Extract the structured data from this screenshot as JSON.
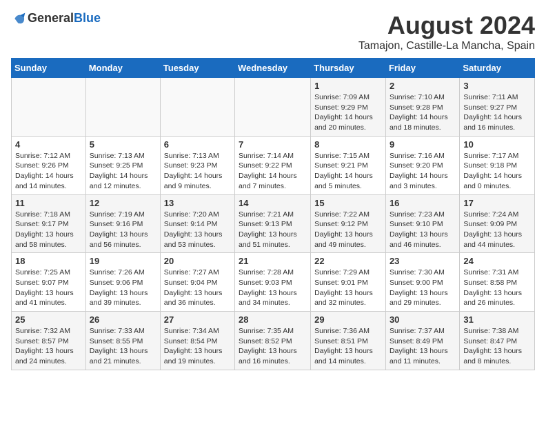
{
  "logo": {
    "text_general": "General",
    "text_blue": "Blue"
  },
  "title": "August 2024",
  "subtitle": "Tamajon, Castille-La Mancha, Spain",
  "weekdays": [
    "Sunday",
    "Monday",
    "Tuesday",
    "Wednesday",
    "Thursday",
    "Friday",
    "Saturday"
  ],
  "weeks": [
    [
      {
        "day": "",
        "content": ""
      },
      {
        "day": "",
        "content": ""
      },
      {
        "day": "",
        "content": ""
      },
      {
        "day": "",
        "content": ""
      },
      {
        "day": "1",
        "content": "Sunrise: 7:09 AM\nSunset: 9:29 PM\nDaylight: 14 hours and 20 minutes."
      },
      {
        "day": "2",
        "content": "Sunrise: 7:10 AM\nSunset: 9:28 PM\nDaylight: 14 hours and 18 minutes."
      },
      {
        "day": "3",
        "content": "Sunrise: 7:11 AM\nSunset: 9:27 PM\nDaylight: 14 hours and 16 minutes."
      }
    ],
    [
      {
        "day": "4",
        "content": "Sunrise: 7:12 AM\nSunset: 9:26 PM\nDaylight: 14 hours and 14 minutes."
      },
      {
        "day": "5",
        "content": "Sunrise: 7:13 AM\nSunset: 9:25 PM\nDaylight: 14 hours and 12 minutes."
      },
      {
        "day": "6",
        "content": "Sunrise: 7:13 AM\nSunset: 9:23 PM\nDaylight: 14 hours and 9 minutes."
      },
      {
        "day": "7",
        "content": "Sunrise: 7:14 AM\nSunset: 9:22 PM\nDaylight: 14 hours and 7 minutes."
      },
      {
        "day": "8",
        "content": "Sunrise: 7:15 AM\nSunset: 9:21 PM\nDaylight: 14 hours and 5 minutes."
      },
      {
        "day": "9",
        "content": "Sunrise: 7:16 AM\nSunset: 9:20 PM\nDaylight: 14 hours and 3 minutes."
      },
      {
        "day": "10",
        "content": "Sunrise: 7:17 AM\nSunset: 9:18 PM\nDaylight: 14 hours and 0 minutes."
      }
    ],
    [
      {
        "day": "11",
        "content": "Sunrise: 7:18 AM\nSunset: 9:17 PM\nDaylight: 13 hours and 58 minutes."
      },
      {
        "day": "12",
        "content": "Sunrise: 7:19 AM\nSunset: 9:16 PM\nDaylight: 13 hours and 56 minutes."
      },
      {
        "day": "13",
        "content": "Sunrise: 7:20 AM\nSunset: 9:14 PM\nDaylight: 13 hours and 53 minutes."
      },
      {
        "day": "14",
        "content": "Sunrise: 7:21 AM\nSunset: 9:13 PM\nDaylight: 13 hours and 51 minutes."
      },
      {
        "day": "15",
        "content": "Sunrise: 7:22 AM\nSunset: 9:12 PM\nDaylight: 13 hours and 49 minutes."
      },
      {
        "day": "16",
        "content": "Sunrise: 7:23 AM\nSunset: 9:10 PM\nDaylight: 13 hours and 46 minutes."
      },
      {
        "day": "17",
        "content": "Sunrise: 7:24 AM\nSunset: 9:09 PM\nDaylight: 13 hours and 44 minutes."
      }
    ],
    [
      {
        "day": "18",
        "content": "Sunrise: 7:25 AM\nSunset: 9:07 PM\nDaylight: 13 hours and 41 minutes."
      },
      {
        "day": "19",
        "content": "Sunrise: 7:26 AM\nSunset: 9:06 PM\nDaylight: 13 hours and 39 minutes."
      },
      {
        "day": "20",
        "content": "Sunrise: 7:27 AM\nSunset: 9:04 PM\nDaylight: 13 hours and 36 minutes."
      },
      {
        "day": "21",
        "content": "Sunrise: 7:28 AM\nSunset: 9:03 PM\nDaylight: 13 hours and 34 minutes."
      },
      {
        "day": "22",
        "content": "Sunrise: 7:29 AM\nSunset: 9:01 PM\nDaylight: 13 hours and 32 minutes."
      },
      {
        "day": "23",
        "content": "Sunrise: 7:30 AM\nSunset: 9:00 PM\nDaylight: 13 hours and 29 minutes."
      },
      {
        "day": "24",
        "content": "Sunrise: 7:31 AM\nSunset: 8:58 PM\nDaylight: 13 hours and 26 minutes."
      }
    ],
    [
      {
        "day": "25",
        "content": "Sunrise: 7:32 AM\nSunset: 8:57 PM\nDaylight: 13 hours and 24 minutes."
      },
      {
        "day": "26",
        "content": "Sunrise: 7:33 AM\nSunset: 8:55 PM\nDaylight: 13 hours and 21 minutes."
      },
      {
        "day": "27",
        "content": "Sunrise: 7:34 AM\nSunset: 8:54 PM\nDaylight: 13 hours and 19 minutes."
      },
      {
        "day": "28",
        "content": "Sunrise: 7:35 AM\nSunset: 8:52 PM\nDaylight: 13 hours and 16 minutes."
      },
      {
        "day": "29",
        "content": "Sunrise: 7:36 AM\nSunset: 8:51 PM\nDaylight: 13 hours and 14 minutes."
      },
      {
        "day": "30",
        "content": "Sunrise: 7:37 AM\nSunset: 8:49 PM\nDaylight: 13 hours and 11 minutes."
      },
      {
        "day": "31",
        "content": "Sunrise: 7:38 AM\nSunset: 8:47 PM\nDaylight: 13 hours and 8 minutes."
      }
    ]
  ]
}
